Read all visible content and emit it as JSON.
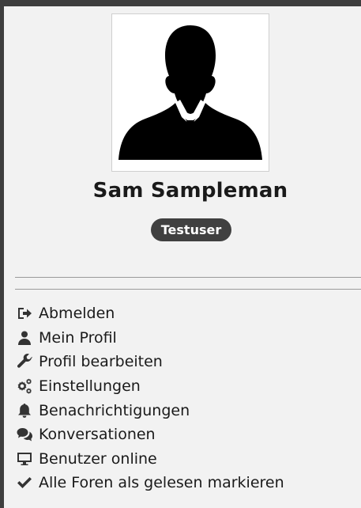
{
  "user": {
    "name": "Sam Sampleman",
    "role_badge": "Testuser"
  },
  "menu": [
    {
      "label": "Abmelden",
      "icon": "sign-out-icon"
    },
    {
      "label": "Mein Profil",
      "icon": "user-icon"
    },
    {
      "label": "Profil bearbeiten",
      "icon": "wrench-icon"
    },
    {
      "label": "Einstellungen",
      "icon": "cogs-icon"
    },
    {
      "label": "Benachrichtigungen",
      "icon": "bell-icon"
    },
    {
      "label": "Konversationen",
      "icon": "comments-icon"
    },
    {
      "label": "Benutzer online",
      "icon": "desktop-icon"
    },
    {
      "label": "Alle Foren als gelesen markieren",
      "icon": "check-icon"
    }
  ],
  "colors": {
    "panel_background": "#f2f2f2",
    "badge_background": "#404040",
    "text": "#1a1a1a",
    "icon": "#333333"
  }
}
